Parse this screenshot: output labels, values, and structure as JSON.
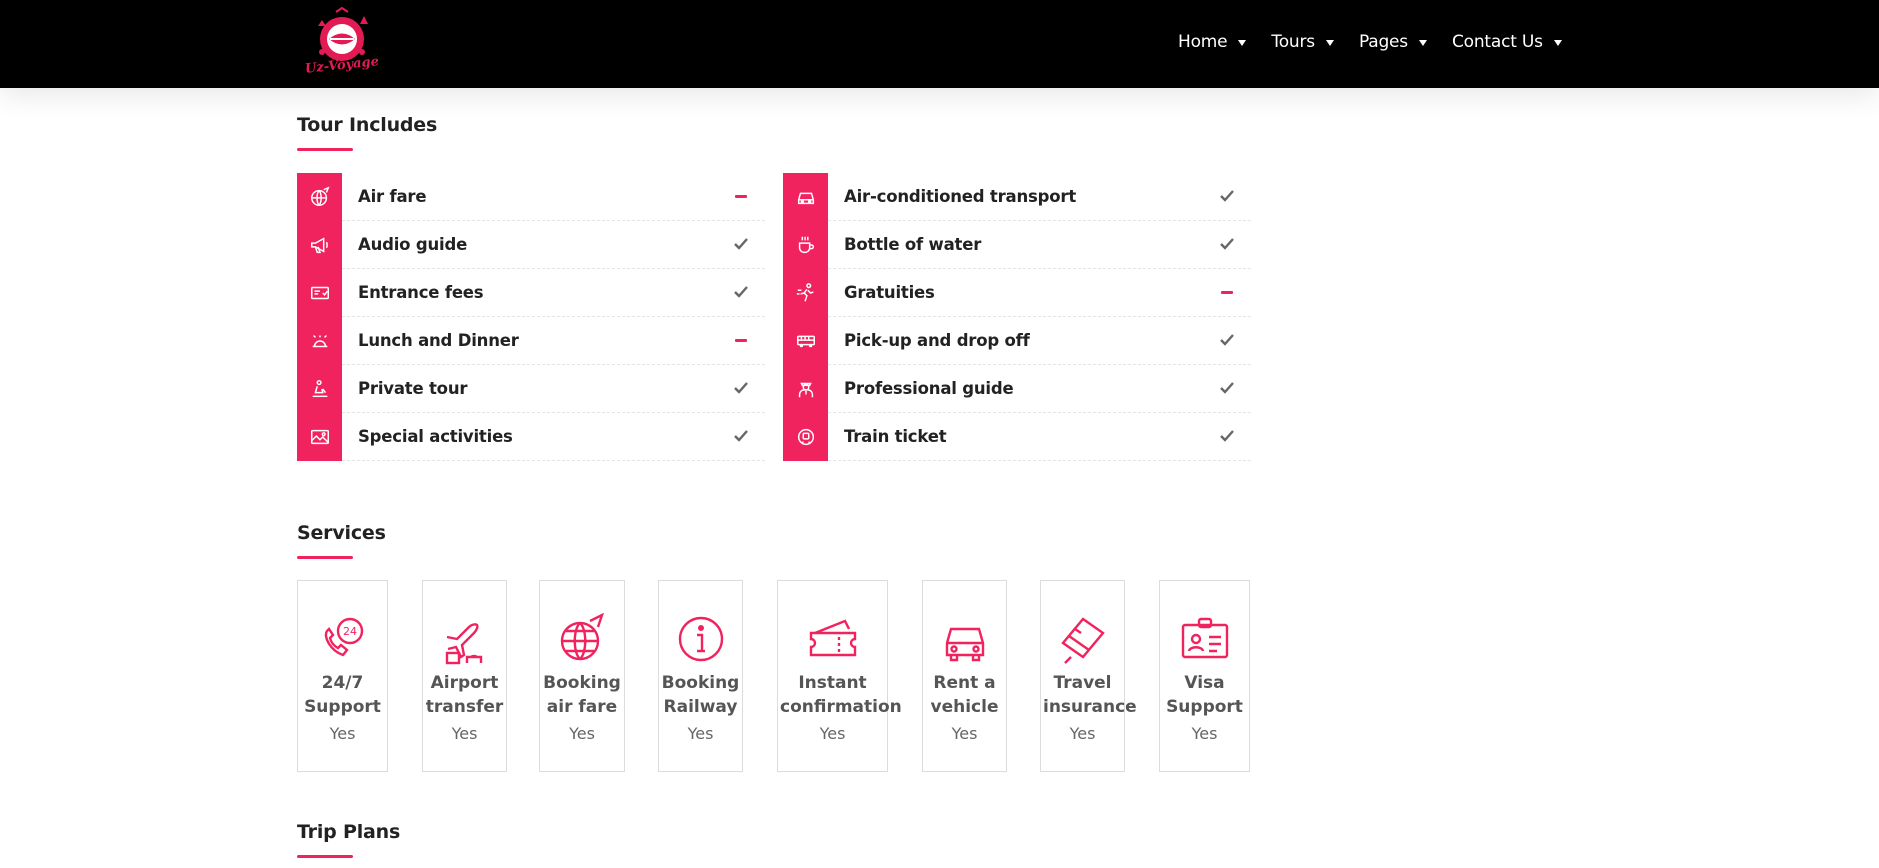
{
  "brand": {
    "logo_text": "Uz-Voyage",
    "accent_color": "#f0235f",
    "header_bg": "#000000"
  },
  "nav": [
    {
      "label": "Home",
      "icon": "caret-down-icon"
    },
    {
      "label": "Tours",
      "icon": "caret-down-icon"
    },
    {
      "label": "Pages",
      "icon": "caret-down-icon"
    },
    {
      "label": "Contact Us",
      "icon": "caret-down-icon"
    }
  ],
  "tour_includes": {
    "title": "Tour Includes",
    "left": [
      {
        "label": "Air fare",
        "icon": "globe-plane-icon",
        "status": "no"
      },
      {
        "label": "Audio guide",
        "icon": "megaphone-icon",
        "status": "yes"
      },
      {
        "label": "Entrance fees",
        "icon": "ticket-icon",
        "status": "yes"
      },
      {
        "label": "Lunch and Dinner",
        "icon": "food-cloche-icon",
        "status": "no"
      },
      {
        "label": "Private tour",
        "icon": "private-tour-icon",
        "status": "yes"
      },
      {
        "label": "Special activities",
        "icon": "picture-icon",
        "status": "yes"
      }
    ],
    "right": [
      {
        "label": "Air-conditioned transport",
        "icon": "car-icon",
        "status": "yes"
      },
      {
        "label": "Bottle of water",
        "icon": "cup-icon",
        "status": "yes"
      },
      {
        "label": "Gratuities",
        "icon": "running-icon",
        "status": "no"
      },
      {
        "label": "Pick-up and drop off",
        "icon": "bus-icon",
        "status": "yes"
      },
      {
        "label": "Professional guide",
        "icon": "guide-person-icon",
        "status": "yes"
      },
      {
        "label": "Train ticket",
        "icon": "train-ticket-icon",
        "status": "yes"
      }
    ]
  },
  "services": {
    "title": "Services",
    "items": [
      {
        "name": "24/7 Support",
        "value": "Yes",
        "icon": "support-24-icon"
      },
      {
        "name": "Airport transfer",
        "value": "Yes",
        "icon": "airplane-icon"
      },
      {
        "name": "Booking air fare",
        "value": "Yes",
        "icon": "globe-plane-icon"
      },
      {
        "name": "Booking Railway",
        "value": "Yes",
        "icon": "info-icon"
      },
      {
        "name": "Instant confirmation",
        "value": "Yes",
        "icon": "ticket-icon"
      },
      {
        "name": "Rent a vehicle",
        "value": "Yes",
        "icon": "car-icon"
      },
      {
        "name": "Travel insurance",
        "value": "Yes",
        "icon": "credit-card-icon"
      },
      {
        "name": "Visa Support",
        "value": "Yes",
        "icon": "id-card-icon"
      }
    ]
  },
  "trip_plans": {
    "title": "Trip Plans"
  }
}
